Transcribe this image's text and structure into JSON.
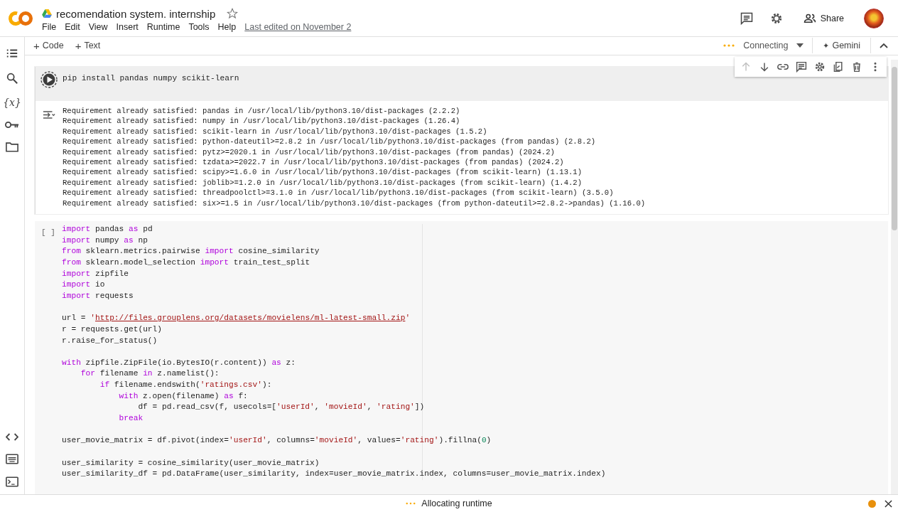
{
  "notebook": {
    "title": "recomendation system. internship",
    "starred": false,
    "last_edited": "Last edited on November 2"
  },
  "menu": [
    {
      "label": "File"
    },
    {
      "label": "Edit"
    },
    {
      "label": "View"
    },
    {
      "label": "Insert"
    },
    {
      "label": "Runtime"
    },
    {
      "label": "Tools"
    },
    {
      "label": "Help"
    }
  ],
  "header_actions": {
    "share": "Share"
  },
  "sidebar": {
    "top": [
      {
        "kind": "toc"
      },
      {
        "kind": "search"
      },
      {
        "kind": "variables",
        "glyph": "{x}"
      },
      {
        "kind": "secrets"
      },
      {
        "kind": "files"
      }
    ],
    "bottom": [
      {
        "kind": "snippets"
      },
      {
        "kind": "palette"
      },
      {
        "kind": "terminal"
      }
    ]
  },
  "toolbar": {
    "add": [
      {
        "icon": "+",
        "label": "Code"
      },
      {
        "icon": "+",
        "label": "Text"
      }
    ],
    "runtime_status": "Connecting",
    "gemini": {
      "icon": "✦",
      "label": "Gemini"
    }
  },
  "cell_toolbar": [
    {
      "kind": "up",
      "disabled": true
    },
    {
      "kind": "down",
      "disabled": false
    },
    {
      "kind": "link",
      "disabled": false
    },
    {
      "kind": "comment",
      "disabled": false
    },
    {
      "kind": "settings",
      "disabled": false
    },
    {
      "kind": "mirror",
      "disabled": false
    },
    {
      "kind": "delete",
      "disabled": false
    },
    {
      "kind": "more",
      "disabled": false
    }
  ],
  "cells": [
    {
      "kind": "running",
      "source": "pip install pandas numpy scikit-learn",
      "output": [
        "Requirement already satisfied: pandas in /usr/local/lib/python3.10/dist-packages (2.2.2)",
        "Requirement already satisfied: numpy in /usr/local/lib/python3.10/dist-packages (1.26.4)",
        "Requirement already satisfied: scikit-learn in /usr/local/lib/python3.10/dist-packages (1.5.2)",
        "Requirement already satisfied: python-dateutil>=2.8.2 in /usr/local/lib/python3.10/dist-packages (from pandas) (2.8.2)",
        "Requirement already satisfied: pytz>=2020.1 in /usr/local/lib/python3.10/dist-packages (from pandas) (2024.2)",
        "Requirement already satisfied: tzdata>=2022.7 in /usr/local/lib/python3.10/dist-packages (from pandas) (2024.2)",
        "Requirement already satisfied: scipy>=1.6.0 in /usr/local/lib/python3.10/dist-packages (from scikit-learn) (1.13.1)",
        "Requirement already satisfied: joblib>=1.2.0 in /usr/local/lib/python3.10/dist-packages (from scikit-learn) (1.4.2)",
        "Requirement already satisfied: threadpoolctl>=3.1.0 in /usr/local/lib/python3.10/dist-packages (from scikit-learn) (3.5.0)",
        "Requirement already satisfied: six>=1.5 in /usr/local/lib/python3.10/dist-packages (from python-dateutil>=2.8.2->pandas) (1.16.0)"
      ]
    },
    {
      "kind": "idle",
      "prompt": "[ ]",
      "lines": [
        {
          "kind": "code",
          "tokens": [
            {
              "kind": "kw",
              "text": "import"
            },
            {
              "kind": "plain",
              "text": " pandas "
            },
            {
              "kind": "kw",
              "text": "as"
            },
            {
              "kind": "plain",
              "text": " pd"
            }
          ]
        },
        {
          "kind": "code",
          "tokens": [
            {
              "kind": "kw",
              "text": "import"
            },
            {
              "kind": "plain",
              "text": " numpy "
            },
            {
              "kind": "kw",
              "text": "as"
            },
            {
              "kind": "plain",
              "text": " np"
            }
          ]
        },
        {
          "kind": "code",
          "tokens": [
            {
              "kind": "kw",
              "text": "from"
            },
            {
              "kind": "plain",
              "text": " sklearn.metrics.pairwise "
            },
            {
              "kind": "kw",
              "text": "import"
            },
            {
              "kind": "plain",
              "text": " cosine_similarity"
            }
          ]
        },
        {
          "kind": "code",
          "tokens": [
            {
              "kind": "kw",
              "text": "from"
            },
            {
              "kind": "plain",
              "text": " sklearn.model_selection "
            },
            {
              "kind": "kw",
              "text": "import"
            },
            {
              "kind": "plain",
              "text": " train_test_split"
            }
          ]
        },
        {
          "kind": "code",
          "tokens": [
            {
              "kind": "kw",
              "text": "import"
            },
            {
              "kind": "plain",
              "text": " zipfile"
            }
          ]
        },
        {
          "kind": "code",
          "tokens": [
            {
              "kind": "kw",
              "text": "import"
            },
            {
              "kind": "plain",
              "text": " io"
            }
          ]
        },
        {
          "kind": "code",
          "tokens": [
            {
              "kind": "kw",
              "text": "import"
            },
            {
              "kind": "plain",
              "text": " requests"
            }
          ]
        },
        {
          "kind": "blank"
        },
        {
          "kind": "code",
          "tokens": [
            {
              "kind": "plain",
              "text": "url = "
            },
            {
              "kind": "str",
              "text": "'"
            },
            {
              "kind": "url",
              "text": "http://files.grouplens.org/datasets/movielens/ml-latest-small.zip"
            },
            {
              "kind": "str",
              "text": "'"
            }
          ]
        },
        {
          "kind": "code",
          "tokens": [
            {
              "kind": "plain",
              "text": "r = requests.get(url)"
            }
          ]
        },
        {
          "kind": "code",
          "tokens": [
            {
              "kind": "plain",
              "text": "r.raise_for_status()"
            }
          ]
        },
        {
          "kind": "blank"
        },
        {
          "kind": "code",
          "tokens": [
            {
              "kind": "kw",
              "text": "with"
            },
            {
              "kind": "plain",
              "text": " zipfile.ZipFile(io.BytesIO(r.content)) "
            },
            {
              "kind": "kw",
              "text": "as"
            },
            {
              "kind": "plain",
              "text": " z:"
            }
          ],
          "children": [
            {
              "kind": "code",
              "tokens": [
                {
                  "kind": "kw",
                  "text": "for"
                },
                {
                  "kind": "plain",
                  "text": " filename "
                },
                {
                  "kind": "kw",
                  "text": "in"
                },
                {
                  "kind": "plain",
                  "text": " z.namelist():"
                }
              ],
              "children": [
                {
                  "kind": "code",
                  "tokens": [
                    {
                      "kind": "kw",
                      "text": "if"
                    },
                    {
                      "kind": "plain",
                      "text": " filename.endswith("
                    },
                    {
                      "kind": "str",
                      "text": "'ratings.csv'"
                    },
                    {
                      "kind": "plain",
                      "text": "):"
                    }
                  ],
                  "children": [
                    {
                      "kind": "code",
                      "tokens": [
                        {
                          "kind": "kw",
                          "text": "with"
                        },
                        {
                          "kind": "plain",
                          "text": " z.open(filename) "
                        },
                        {
                          "kind": "kw",
                          "text": "as"
                        },
                        {
                          "kind": "plain",
                          "text": " f:"
                        }
                      ],
                      "children": [
                        {
                          "kind": "code",
                          "tokens": [
                            {
                              "kind": "plain",
                              "text": "df = pd.read_csv(f, usecols=["
                            },
                            {
                              "kind": "str",
                              "text": "'userId'"
                            },
                            {
                              "kind": "plain",
                              "text": ", "
                            },
                            {
                              "kind": "str",
                              "text": "'movieId'"
                            },
                            {
                              "kind": "plain",
                              "text": ", "
                            },
                            {
                              "kind": "str",
                              "text": "'rating'"
                            },
                            {
                              "kind": "plain",
                              "text": "])"
                            }
                          ]
                        }
                      ]
                    },
                    {
                      "kind": "code",
                      "tokens": [
                        {
                          "kind": "kw",
                          "text": "break"
                        }
                      ]
                    }
                  ]
                }
              ]
            }
          ]
        },
        {
          "kind": "blank"
        },
        {
          "kind": "code",
          "tokens": [
            {
              "kind": "plain",
              "text": "user_movie_matrix = df.pivot(index="
            },
            {
              "kind": "str",
              "text": "'userId'"
            },
            {
              "kind": "plain",
              "text": ", columns="
            },
            {
              "kind": "str",
              "text": "'movieId'"
            },
            {
              "kind": "plain",
              "text": ", values="
            },
            {
              "kind": "str",
              "text": "'rating'"
            },
            {
              "kind": "plain",
              "text": ").fillna("
            },
            {
              "kind": "num",
              "text": "0"
            },
            {
              "kind": "plain",
              "text": ")"
            }
          ]
        },
        {
          "kind": "blank"
        },
        {
          "kind": "code",
          "tokens": [
            {
              "kind": "plain",
              "text": "user_similarity = cosine_similarity(user_movie_matrix)"
            }
          ]
        },
        {
          "kind": "code",
          "tokens": [
            {
              "kind": "plain",
              "text": "user_similarity_df = pd.DataFrame(user_similarity, index=user_movie_matrix.index, columns=user_movie_matrix.index)"
            }
          ]
        }
      ]
    }
  ],
  "status_bar": {
    "message": "Allocating runtime"
  }
}
